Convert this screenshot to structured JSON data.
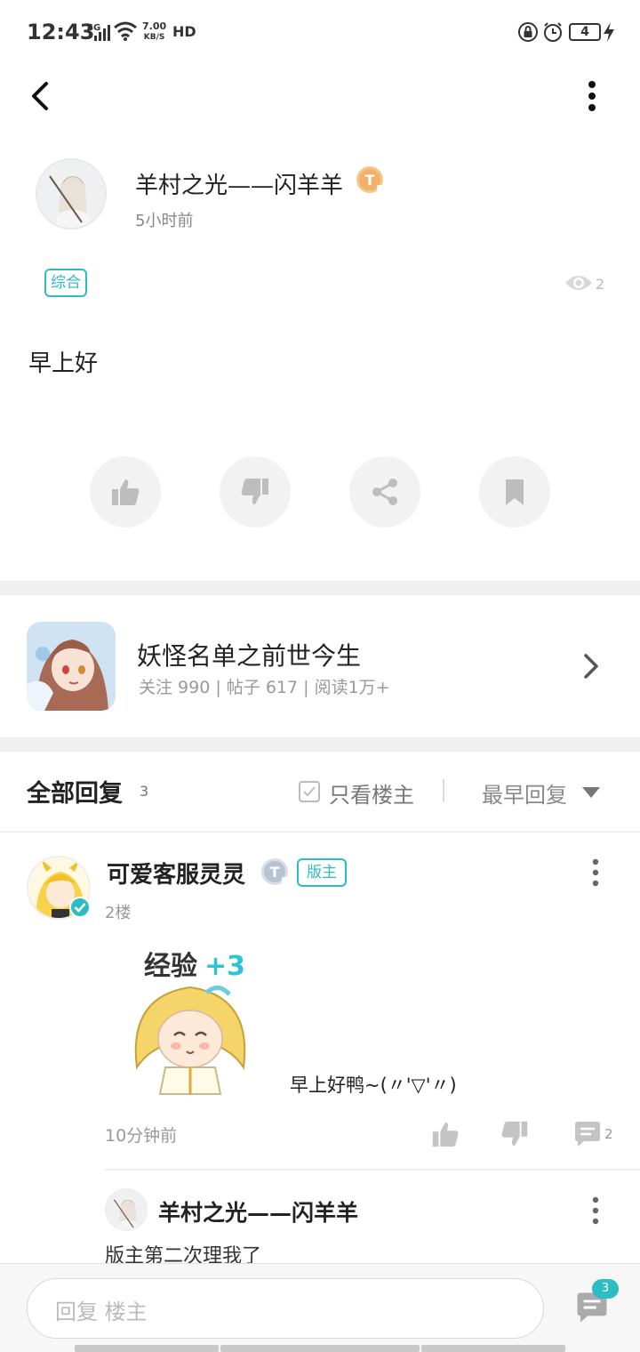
{
  "status_bar": {
    "time": "12:43",
    "network": "4G",
    "speed_value": "7.00",
    "speed_unit": "KB/S",
    "hd": "HD",
    "battery": "4"
  },
  "post": {
    "author": "羊村之光——闪羊羊",
    "author_badge": "T",
    "time": "5小时前",
    "tag": "综合",
    "views": "2",
    "body": "早上好"
  },
  "forum": {
    "name": "妖怪名单之前世今生",
    "stats": "关注 990 | 帖子 617 | 阅读1万+"
  },
  "replies": {
    "title": "全部回复",
    "count": "3",
    "only_op_label": "只看楼主",
    "sort_label": "最早回复",
    "items": [
      {
        "name": "可爱客服灵灵",
        "badge": "T",
        "role": "版主",
        "floor": "2楼",
        "text": "早上好鸭~(〃'▽'〃)",
        "sticker_text": "经验",
        "sticker_bonus": "+3",
        "time": "10分钟前",
        "comment_count": "2",
        "sub_reply": {
          "name": "羊村之光——闪羊羊",
          "text": "版主第二次理我了"
        }
      }
    ]
  },
  "bottom": {
    "placeholder": "回复 楼主",
    "comment_badge": "3"
  },
  "colors": {
    "accent": "#2dbcc4",
    "muted": "#999999",
    "action_bg": "#f2f2f2"
  }
}
